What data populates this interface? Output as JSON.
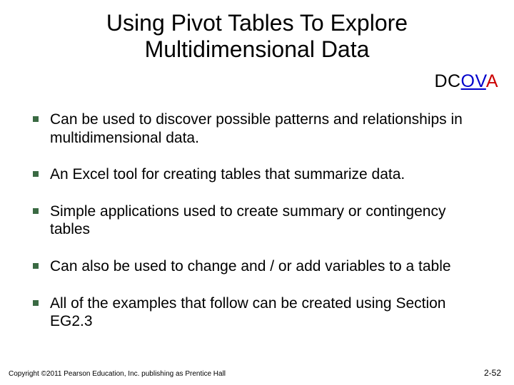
{
  "title_line1": "Using Pivot Tables To Explore",
  "title_line2": "Multidimensional Data",
  "tag": {
    "pre": "DC",
    "mid": "OV",
    "last": "A"
  },
  "bullets": [
    "Can be used to discover possible patterns and relationships in multidimensional data.",
    "An Excel tool for creating tables that summarize data.",
    "Simple applications used to create summary or contingency tables",
    "Can also be used to change and / or add variables to a table",
    "All of the examples that follow can be created using Section EG2.3"
  ],
  "footer_left": "Copyright ©2011 Pearson Education, Inc. publishing as Prentice Hall",
  "footer_right": "2-52"
}
